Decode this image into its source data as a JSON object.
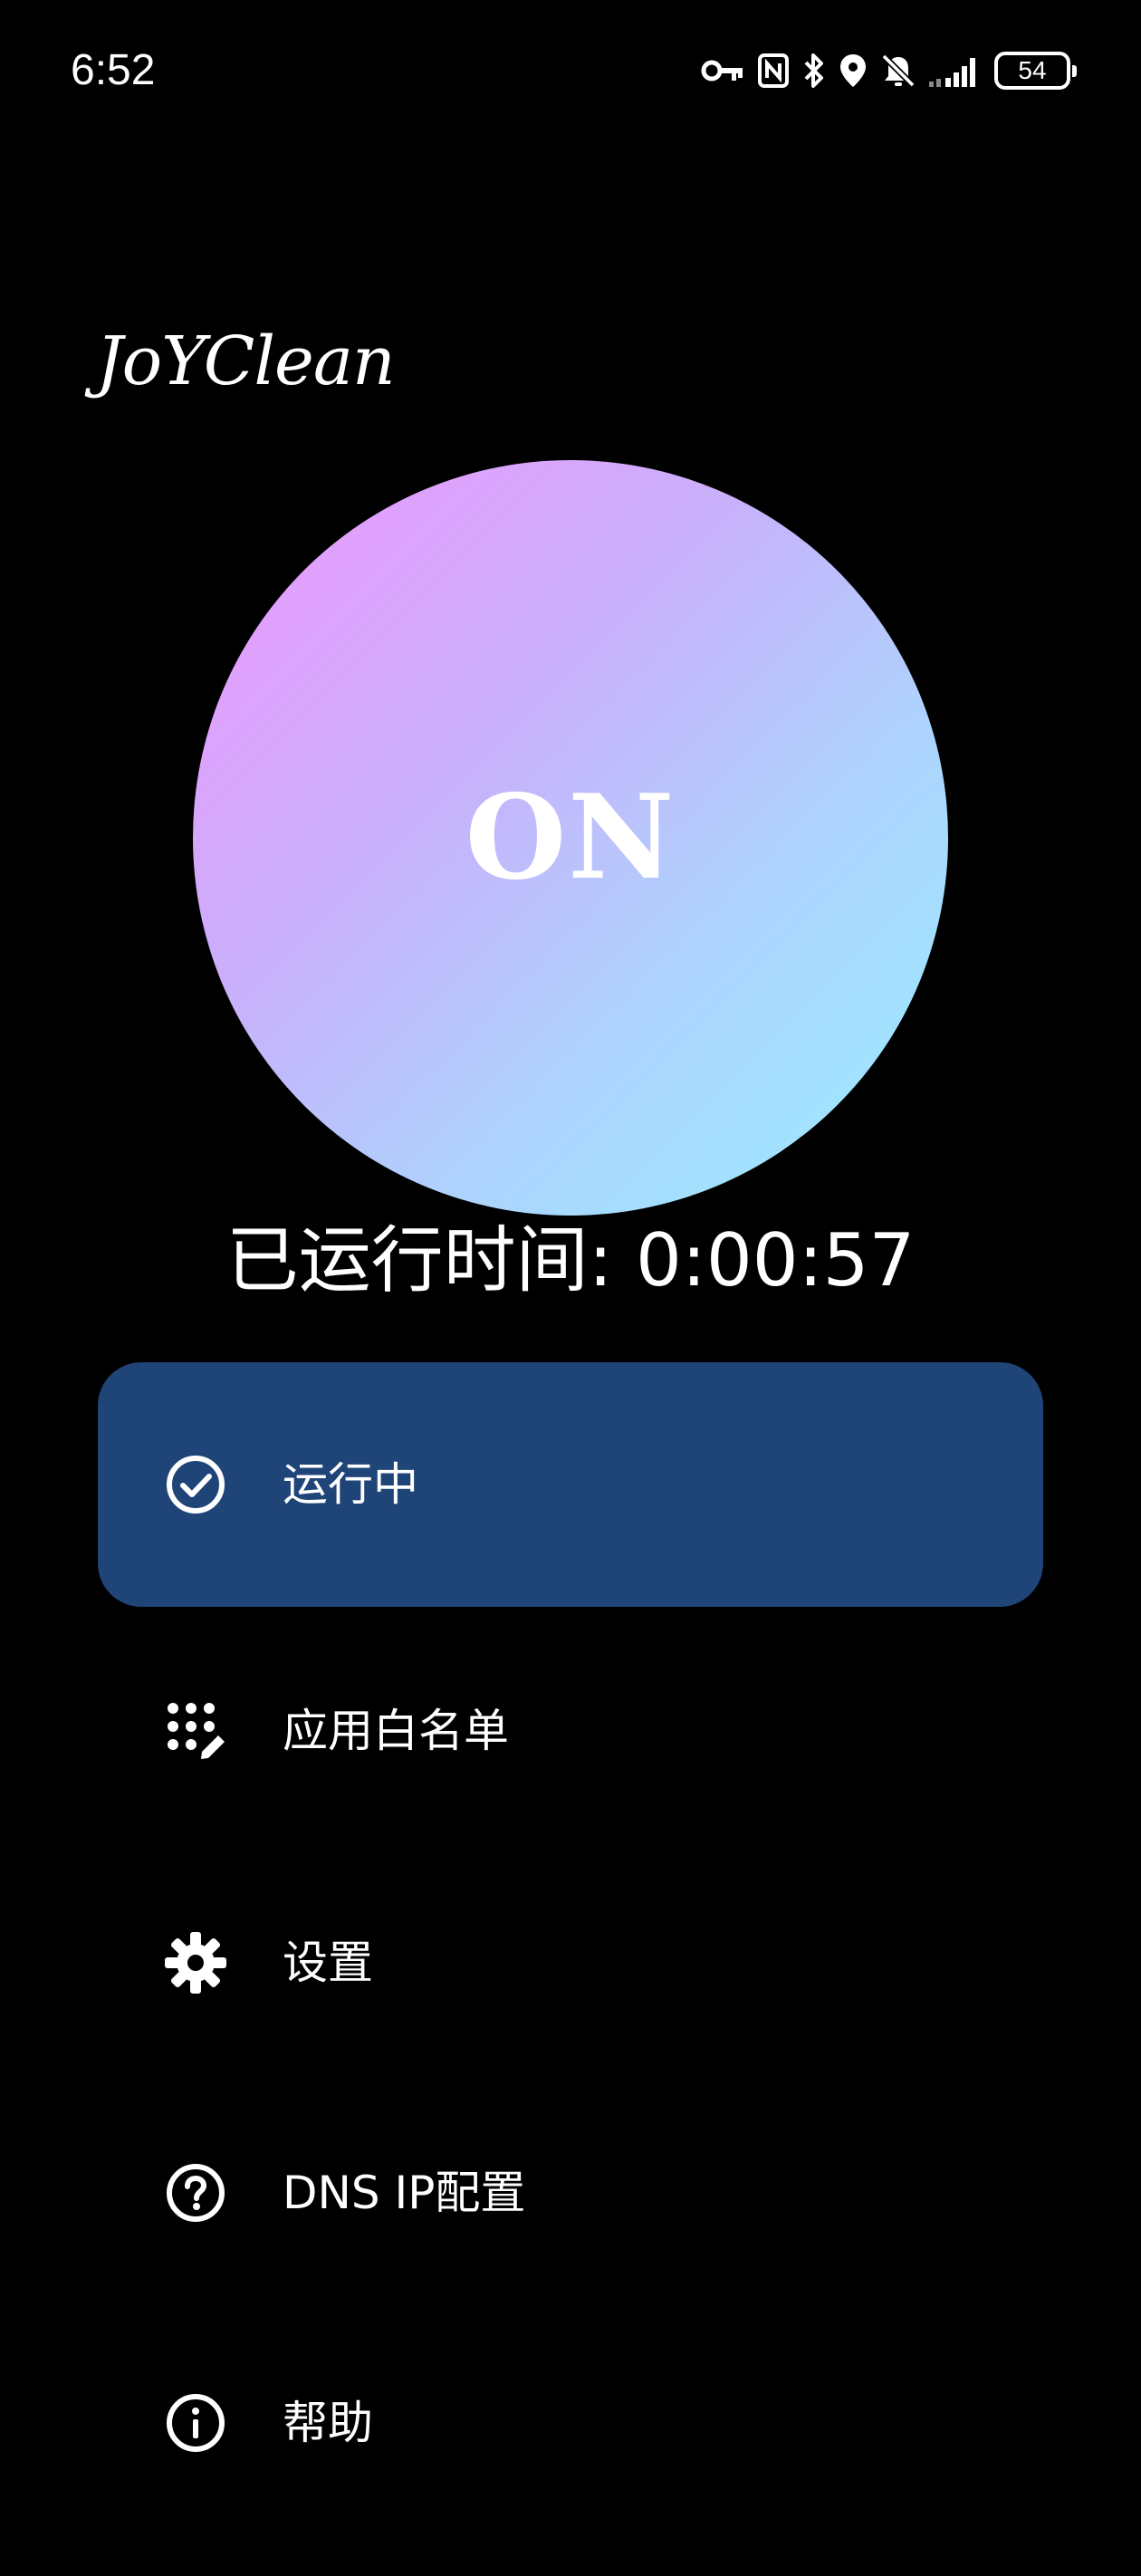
{
  "status_bar": {
    "time": "6:52",
    "battery_level": "54",
    "icons": [
      "vpn-key-icon",
      "nfc-icon",
      "bluetooth-icon",
      "location-icon",
      "bell-muted-icon",
      "signal-icon",
      "battery-icon"
    ]
  },
  "app": {
    "logo_text": "JoYClean"
  },
  "power": {
    "state_label": "ON",
    "gradient_colors": [
      "#f096ff",
      "#98eeff"
    ]
  },
  "runtime": {
    "text": "已运行时间: 0:00:57"
  },
  "menu": {
    "items": [
      {
        "label": "运行中",
        "icon": "check-circle-icon",
        "active": true
      },
      {
        "label": "应用白名单",
        "icon": "apps-edit-icon",
        "active": false
      },
      {
        "label": "设置",
        "icon": "gear-icon",
        "active": false
      },
      {
        "label": "DNS IP配置",
        "icon": "help-circle-icon",
        "active": false
      },
      {
        "label": "帮助",
        "icon": "info-icon",
        "active": false
      }
    ],
    "active_color": "#1f4477"
  }
}
